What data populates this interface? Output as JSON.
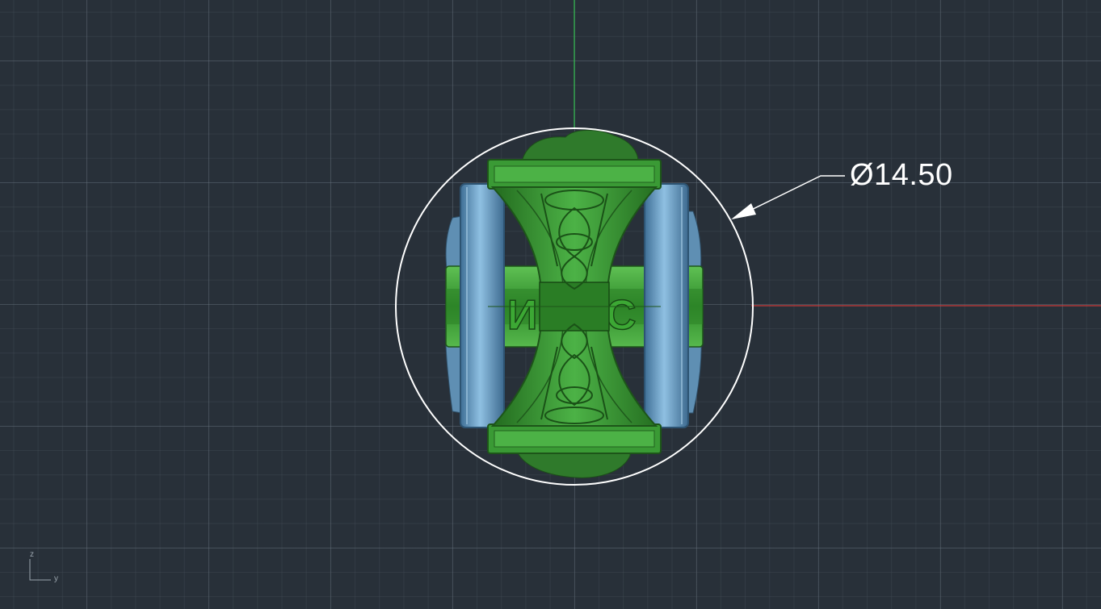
{
  "viewport": {
    "background_color": "#283039",
    "grid_color": "#5b6773"
  },
  "axes": {
    "x_axis_color": "#c83a3a",
    "y_axis_color": "#2fb84a",
    "ucs_label_z": "z",
    "ucs_label_y": "y"
  },
  "dimension": {
    "text": "Ø14.50",
    "color": "#ffffff"
  },
  "model": {
    "body_color": "#3fa33a",
    "ring_color": "#6fa7cf",
    "engraving_left": "И",
    "engraving_right": "С"
  }
}
